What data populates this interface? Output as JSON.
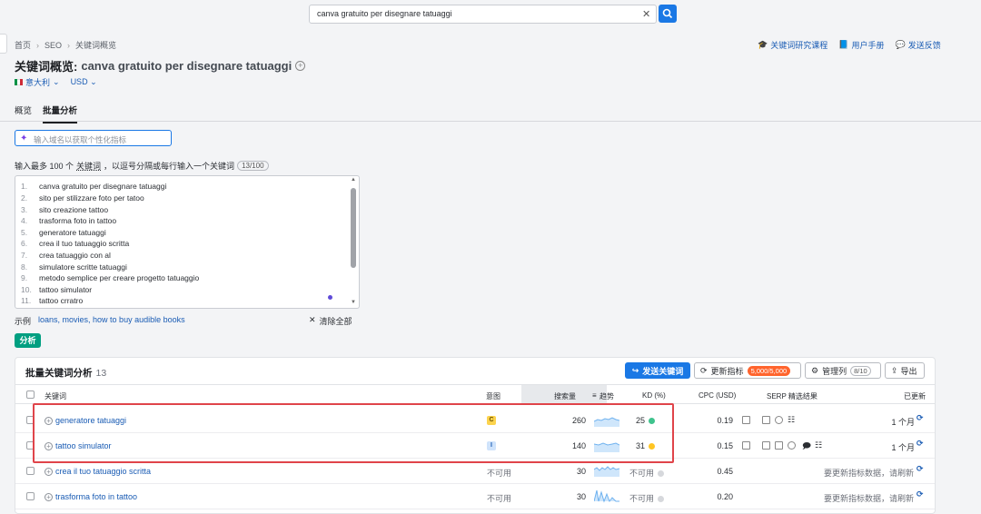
{
  "search": {
    "query": "canva gratuito per disegnare tatuaggi"
  },
  "breadcrumb": [
    "首页",
    "SEO",
    "关键词概览"
  ],
  "top_links": [
    "关键词研究课程",
    "用户手册",
    "发送反馈"
  ],
  "page": {
    "title": "关键词概览:",
    "keyword": "canva gratuito per disegnare tatuaggi",
    "database": "意大利",
    "currency": "USD"
  },
  "tabs": [
    "概览",
    "批量分析"
  ],
  "domain_input": {
    "placeholder": "输入域名以获取个性化指标"
  },
  "hint": {
    "prefix": "输入最多 100 个",
    "link": "关键词",
    "suffix": "，以逗号分隔或每行输入一个关键词",
    "count": "13/100"
  },
  "keyword_lines": [
    "canva gratuito per disegnare tatuaggi",
    "sito per stilizzare foto per tatoo",
    "sito creazione tattoo",
    "trasforma foto in tattoo",
    "generatore tatuaggi",
    "crea il tuo tatuaggio scritta",
    "crea tatuaggio con al",
    "simulatore scritte tatuaggi",
    "metodo semplice per creare progetto tatuaggio",
    "tattoo simulator",
    "tattoo crratro"
  ],
  "examples": {
    "label": "示例",
    "value": "loans, movies, how to buy audible books",
    "clear": "清除全部"
  },
  "analyze_label": "分析",
  "results": {
    "title": "批量关键词分析",
    "count": "13",
    "send_button": "发送关键词",
    "update_button": "更新指标",
    "update_badge": "5,000/5,000",
    "columns_button": "管理列",
    "columns_badge": "8/10",
    "export_button": "导出",
    "headers": {
      "keyword": "关键词",
      "intent": "意图",
      "volume": "搜索量",
      "trend": "趋势",
      "kd": "KD (%)",
      "cpc": "CPC (USD)",
      "serp": "SERP 精选结果",
      "updated": "已更新"
    },
    "rows": [
      {
        "keyword": "generatore tatuaggi",
        "intent": "C",
        "volume": "260",
        "kd": "25",
        "kd_color": "#3fc38d",
        "cpc": "0.19",
        "updated": "1 个月"
      },
      {
        "keyword": "tattoo simulator",
        "intent": "I",
        "volume": "140",
        "kd": "31",
        "kd_color": "#ffc523",
        "cpc": "0.15",
        "updated": "1 个月"
      },
      {
        "keyword": "crea il tuo tatuaggio scritta",
        "intent": "不可用",
        "volume": "30",
        "kd": "不可用",
        "kd_color": "#d6d8dc",
        "cpc": "0.45",
        "updated": "要更新指标数据，请刷新"
      },
      {
        "keyword": "trasforma foto in tattoo",
        "intent": "不可用",
        "volume": "30",
        "kd": "不可用",
        "kd_color": "#d6d8dc",
        "cpc": "0.20",
        "updated": "要更新指标数据，请刷新"
      }
    ]
  },
  "colors": {
    "accent": "#1a78e5",
    "analyze": "#009f81",
    "badge": "#ff642d",
    "highlight": "#e0444a"
  }
}
